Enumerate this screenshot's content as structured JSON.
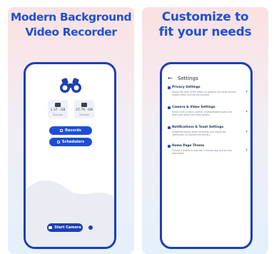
{
  "left_panel": {
    "headline_line1": "Modern Background",
    "headline_line2": "Video Recorder",
    "stats": [
      {
        "value": "1.37 · GB",
        "label": "Storage"
      },
      {
        "value": "27.76 · GB",
        "label": "Storage"
      }
    ],
    "records_label": "Records",
    "schedulers_label": "Schedulers",
    "start_camera_label": "Start Camera"
  },
  "right_panel": {
    "headline_line1": "Customize to",
    "headline_line2": "fit your needs",
    "screen_title": "Settings",
    "items": [
      {
        "title": "Privacy Settings",
        "desc": "Adjust the view of the video, its position and what should happen after clicking the preview."
      },
      {
        "title": "Camera & Video Settings",
        "desc": "Select front or back camera, enable/disable audio and flash, and select the video quality."
      },
      {
        "title": "Notifications & Toast Settings",
        "desc": "Show/hide toasts when recording, and adjust the notification to improve the privacy."
      },
      {
        "title": "Home Page Theme",
        "desc": "Choose a theme to look like a famous app and be less detectable."
      }
    ]
  },
  "colors": {
    "accent": "#1d4fd6",
    "frame": "#1d3fb0"
  }
}
